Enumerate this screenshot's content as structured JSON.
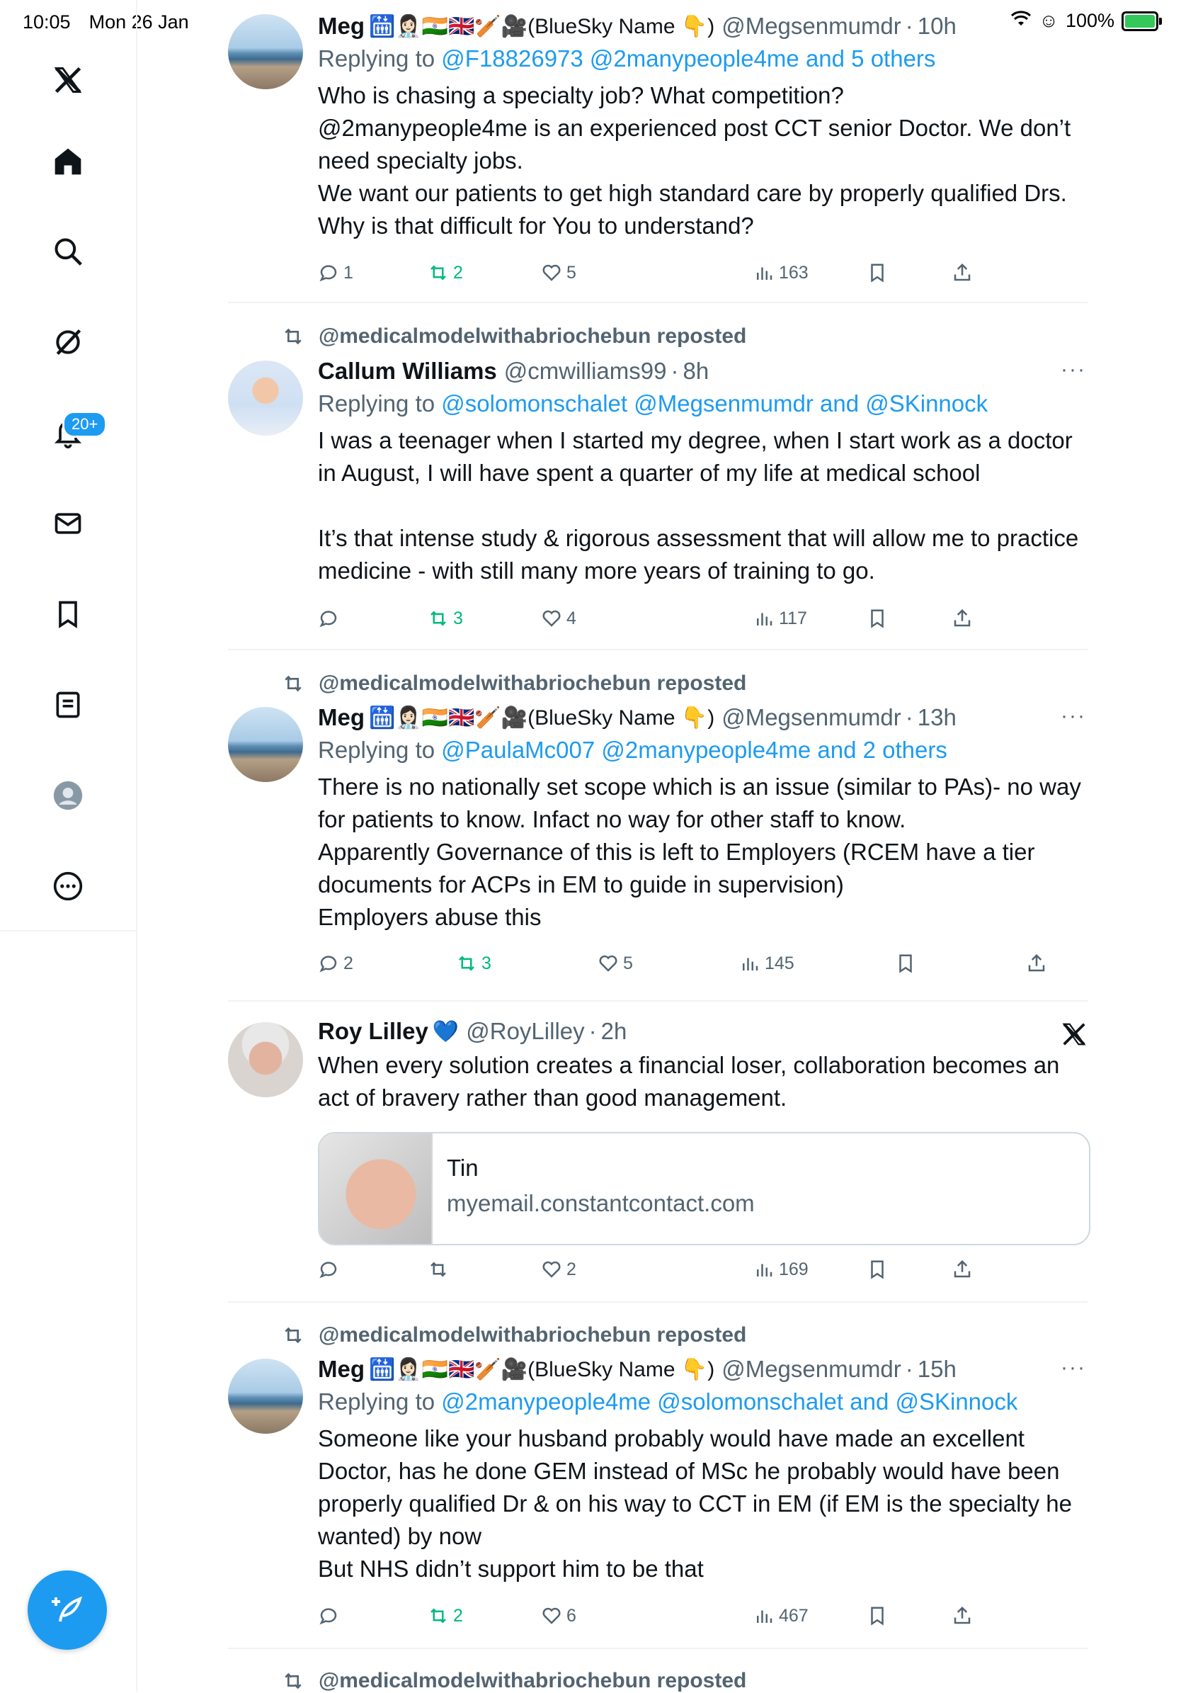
{
  "status": {
    "time": "10:05",
    "date": "Mon 26 Jan",
    "battery": "100%"
  },
  "sidebar": {
    "notifications_badge": "20+"
  },
  "tweets": [
    {
      "reposter": "",
      "name": "Meg",
      "emojis": "🛗👩🏻‍⚕️🇮🇳🇬🇧🏏🎥(BlueSky Name 👇)",
      "handle": "@Megsenmumdr",
      "time": "10h",
      "reply_prefix": "Replying to",
      "reply_targets": "@F18826973 @2manypeople4me and 5 others",
      "body": "Who is chasing a specialty job? What competition?\n@2manypeople4me is an experienced post CCT senior Doctor. We don’t need specialty jobs.\nWe want our patients to get high standard care by properly qualified Drs. Why is that difficult for You to understand?",
      "replies": "1",
      "reposts": "2",
      "likes": "5",
      "views": "163"
    },
    {
      "reposter": "@medicalmodelwithabriochebun reposted",
      "name": "Callum Williams",
      "handle": "@cmwilliams99",
      "time": "8h",
      "reply_prefix": "Replying to",
      "reply_targets": "@solomonschalet @Megsenmumdr and @SKinnock",
      "body": "I was a teenager when I started my degree, when I start work as a doctor in August, I will have spent a quarter of my life at medical school\n\nIt’s that intense study & rigorous assessment that will allow me to practice medicine - with still many more years of training to go.",
      "replies": "",
      "reposts": "3",
      "likes": "4",
      "views": "117"
    },
    {
      "reposter": "@medicalmodelwithabriochebun reposted",
      "name": "Meg",
      "emojis": "🛗👩🏻‍⚕️🇮🇳🇬🇧🏏🎥(BlueSky Name 👇)",
      "handle": "@Megsenmumdr",
      "time": "13h",
      "reply_prefix": "Replying to",
      "reply_targets": "@PaulaMc007 @2manypeople4me and 2 others",
      "body": "There is no nationally set scope which is an issue (similar to PAs)- no way for patients to know. Infact no way for other staff to know.\nApparently Governance of this is left to Employers (RCEM have a tier documents for ACPs in EM to guide in supervision)\nEmployers abuse this",
      "replies": "2",
      "reposts": "3",
      "likes": "5",
      "views": "145"
    },
    {
      "reposter": "",
      "name": "Roy Lilley",
      "emojis": "💙",
      "handle": "@RoyLilley",
      "time": "2h",
      "body": "When every solution creates a financial loser, collaboration becomes an act of bravery rather than good management.",
      "card_title": "Tin",
      "card_domain": "myemail.constantcontact.com",
      "replies": "",
      "reposts": "",
      "likes": "2",
      "views": "169"
    },
    {
      "reposter": "@medicalmodelwithabriochebun reposted",
      "name": "Meg",
      "emojis": "🛗👩🏻‍⚕️🇮🇳🇬🇧🏏🎥(BlueSky Name 👇)",
      "handle": "@Megsenmumdr",
      "time": "15h",
      "reply_prefix": "Replying to",
      "reply_targets": "@2manypeople4me @solomonschalet and @SKinnock",
      "body": "Someone like your husband probably would have made an excellent Doctor, has he done GEM instead of MSc he probably would have been properly qualified Dr & on his way to CCT in EM (if EM is the specialty he wanted) by now\nBut NHS didn’t support him to be that",
      "replies": "",
      "reposts": "2",
      "likes": "6",
      "views": "467"
    },
    {
      "reposter": "@medicalmodelwithabriochebun reposted"
    }
  ]
}
